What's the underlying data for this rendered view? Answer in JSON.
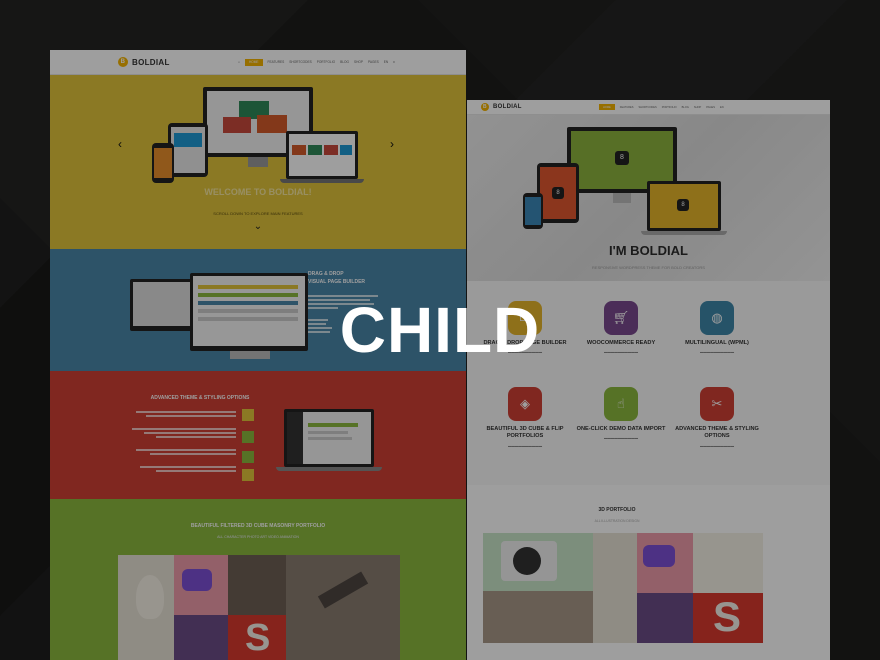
{
  "overlay_title": "CHILD",
  "left_page": {
    "logo_letter": "B",
    "logo_text": "BOLDIAL",
    "nav": [
      "HOME",
      "FEATURES",
      "SHORTCODES",
      "PORTFOLIO",
      "BLOG",
      "SHOP",
      "PAGES",
      "EN",
      "≡"
    ],
    "hero_title": "WELCOME TO BOLDIAL!",
    "hero_sub": "SCROLL DOWN TO EXPLORE MAIN FEATURES",
    "builder_title": "DRAG & DROP",
    "builder_title2": "VISUAL PAGE BUILDER",
    "options_title": "ADVANCED THEME & STYLING OPTIONS",
    "portfolio_title": "BEAUTIFUL FILTERED 3D CUBE MASONRY PORTFOLIO",
    "portfolio_filters": "ALL  CHARACTER  PHOTO  ART  VIDEO  ANIMATION"
  },
  "right_page": {
    "logo_letter": "B",
    "logo_text": "BOLDIAL",
    "hero_title": "I'M BOLDIAL",
    "hero_sub": "RESPONSIVE WORDPRESS THEME FOR BOLD CREATORS",
    "features": [
      {
        "title": "DRAG & DROP PAGE BUILDER",
        "color": "#e6b52a",
        "icon": "monitor-icon"
      },
      {
        "title": "WOOCOMMERCE READY",
        "color": "#7a4a8e",
        "icon": "cart-icon"
      },
      {
        "title": "MULTILINGUAL (WPML)",
        "color": "#3e86a8",
        "icon": "globe-icon"
      },
      {
        "title": "BEAUTIFUL 3D CUBE & FLIP PORTFOLIOS",
        "color": "#cf4035",
        "icon": "cube-icon"
      },
      {
        "title": "ONE-CLICK DEMO DATA IMPORT",
        "color": "#8bb83e",
        "icon": "pointer-icon"
      },
      {
        "title": "ADVANCED THEME & STYLING OPTIONS",
        "color": "#cf4035",
        "icon": "tools-icon"
      }
    ],
    "portfolio_title": "3D PORTFOLIO",
    "portfolio_filters": "ALL  ILLUSTRATION  DESIGN"
  },
  "colors": {
    "yellow": "#e0c43a",
    "blue": "#4a86a8",
    "red": "#cf4035",
    "green": "#8bb83e",
    "accent": "#f4b400"
  }
}
